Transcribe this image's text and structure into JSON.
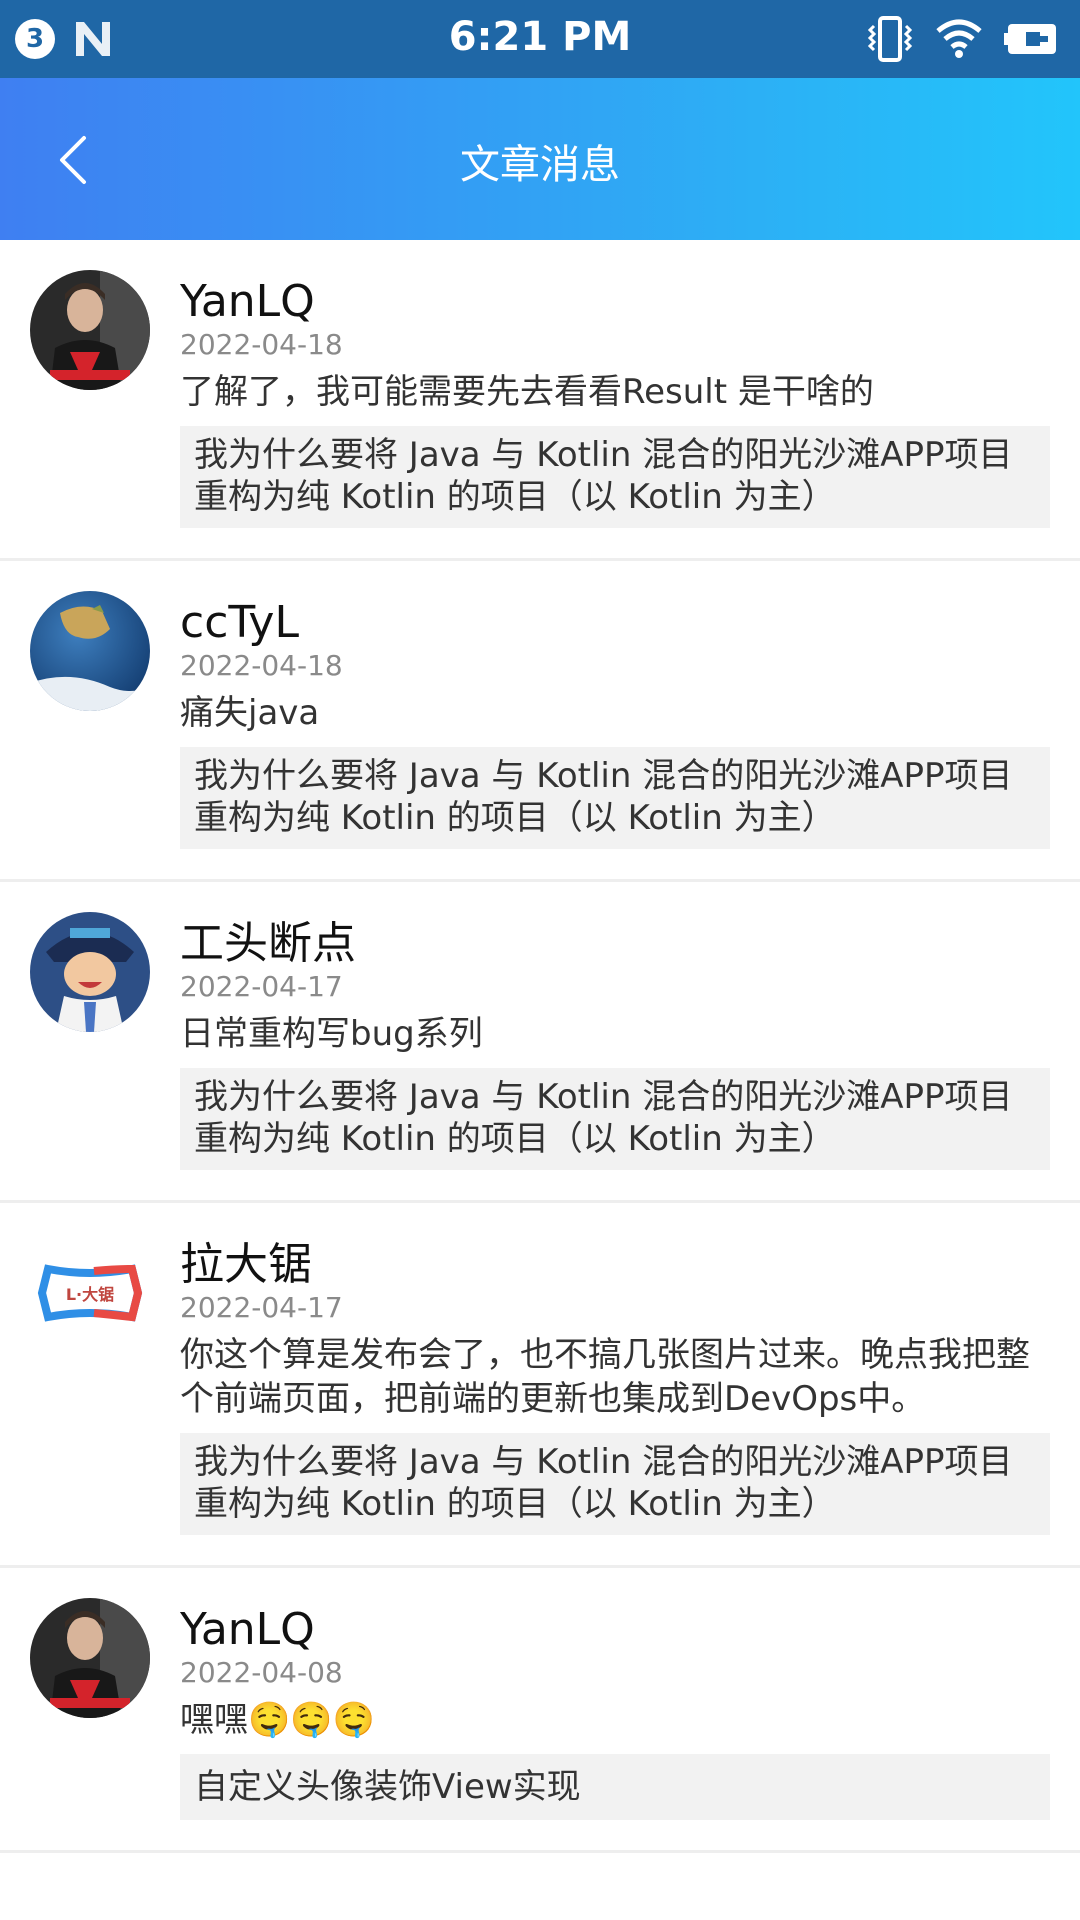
{
  "status_bar": {
    "notification_count": "3",
    "time": "6:21 PM",
    "icons": [
      "notification-badge-icon",
      "n-logo-icon",
      "vibrate-icon",
      "wifi-icon",
      "battery-charging-icon"
    ]
  },
  "header": {
    "title": "文章消息",
    "back_icon": "chevron-left-icon"
  },
  "colors": {
    "status_bar": "#1f67a6",
    "header_gradient_start": "#3f7ff2",
    "header_gradient_end": "#22c5fb",
    "reference_bg": "#f2f2f2",
    "date_text": "#8a8a8a"
  },
  "messages": [
    {
      "name": "YanLQ",
      "date": "2022-04-18",
      "content": "了解了，我可能需要先去看看Result 是干啥的",
      "article": "我为什么要将 Java 与 Kotlin 混合的阳光沙滩APP项目重构为纯 Kotlin 的项目（以 Kotlin 为主）",
      "avatar": "avatar-faze-clan"
    },
    {
      "name": "ccTyL",
      "date": "2022-04-18",
      "content": "痛失java",
      "article": "我为什么要将 Java 与 Kotlin 混合的阳光沙滩APP项目重构为纯 Kotlin 的项目（以 Kotlin 为主）",
      "avatar": "avatar-earth"
    },
    {
      "name": "工头断点",
      "date": "2022-04-17",
      "content": "日常重构写bug系列",
      "article": "我为什么要将 Java 与 Kotlin 混合的阳光沙滩APP项目重构为纯 Kotlin 的项目（以 Kotlin 为主）",
      "avatar": "avatar-cartoon"
    },
    {
      "name": "拉大锯",
      "date": "2022-04-17",
      "content": "你这个算是发布会了，也不搞几张图片过来。晚点我把整个前端页面，把前端的更新也集成到DevOps中。",
      "article": "我为什么要将 Java 与 Kotlin 混合的阳光沙滩APP项目重构为纯 Kotlin 的项目（以 Kotlin 为主）",
      "avatar": "avatar-l-logo",
      "avatar_text": "L·大锯"
    },
    {
      "name": "YanLQ",
      "date": "2022-04-08",
      "content": "嘿嘿🤤🤤🤤",
      "article": "自定义头像装饰View实现",
      "avatar": "avatar-faze-clan"
    }
  ]
}
